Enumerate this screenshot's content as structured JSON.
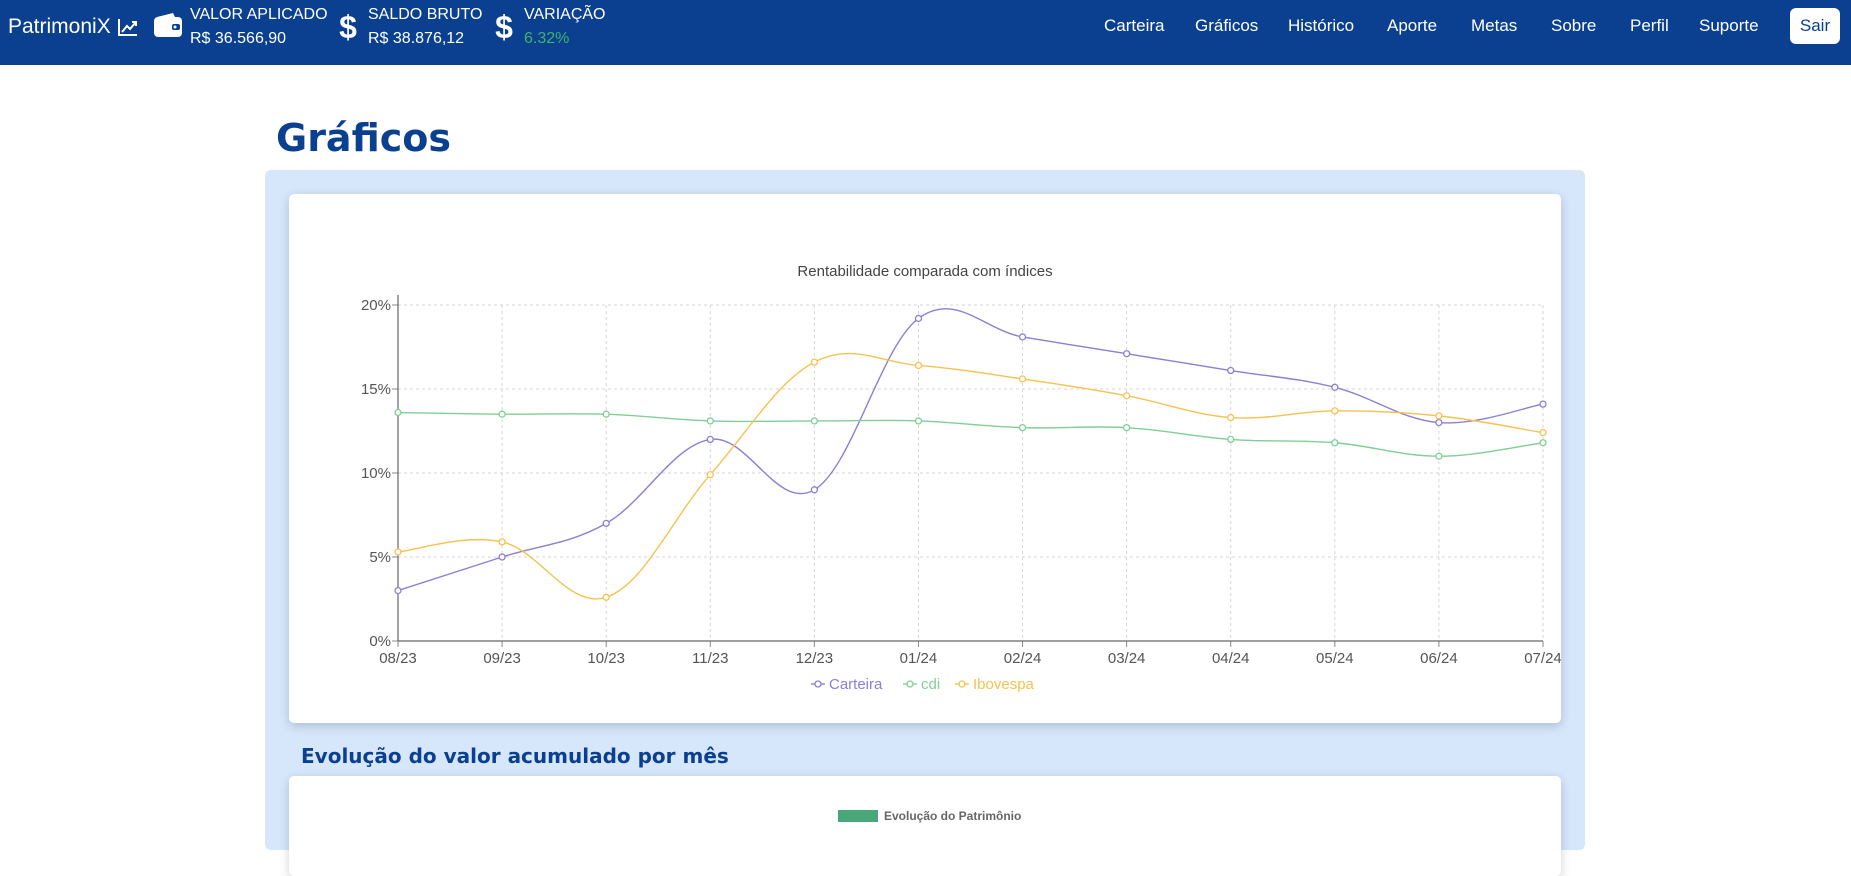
{
  "navbar": {
    "brand": "PatrimoniX",
    "stats": [
      {
        "label": "VALOR APLICADO",
        "value": "R$ 36.566,90"
      },
      {
        "label": "SALDO BRUTO",
        "value": "R$ 38.876,12"
      },
      {
        "label": "VARIAÇÃO",
        "value": "6.32%"
      }
    ],
    "menu": [
      "Carteira",
      "Gráficos",
      "Histórico",
      "Aporte",
      "Metas",
      "Sobre",
      "Perfil",
      "Suporte"
    ],
    "logout": "Sair"
  },
  "page": {
    "title": "Gráficos",
    "section_title": "Evolução do valor acumulado por mês"
  },
  "chart_data": [
    {
      "type": "line",
      "title": "Rentabilidade comparada com índices",
      "x": [
        "08/23",
        "09/23",
        "10/23",
        "11/23",
        "12/23",
        "01/24",
        "02/24",
        "03/24",
        "04/24",
        "05/24",
        "06/24",
        "07/24"
      ],
      "y_ticks": [
        "0%",
        "5%",
        "10%",
        "15%",
        "20%"
      ],
      "ylim": [
        0,
        20
      ],
      "grid": true,
      "legend_position": "bottom",
      "series": [
        {
          "name": "Carteira",
          "color": "#8b7fd6",
          "values": [
            3.0,
            5.0,
            7.0,
            12.0,
            9.0,
            19.2,
            18.1,
            17.1,
            16.1,
            15.1,
            13.0,
            14.1
          ]
        },
        {
          "name": "cdi",
          "color": "#7fcf95",
          "values": [
            13.6,
            13.5,
            13.5,
            13.1,
            13.1,
            13.1,
            12.7,
            12.7,
            12.0,
            11.8,
            11.0,
            11.8
          ]
        },
        {
          "name": "Ibovespa",
          "color": "#f5c24e",
          "values": [
            5.3,
            5.9,
            2.6,
            9.9,
            16.6,
            16.4,
            15.6,
            14.6,
            13.3,
            13.7,
            13.4,
            12.4
          ]
        }
      ]
    },
    {
      "type": "bar",
      "legend": [
        "Evolução do Patrimônio"
      ],
      "color": "#4aa77b"
    }
  ]
}
